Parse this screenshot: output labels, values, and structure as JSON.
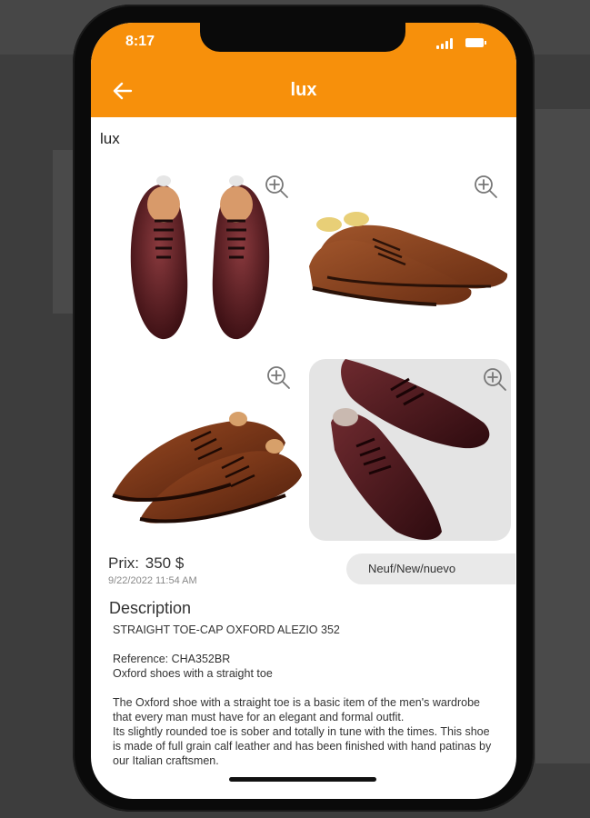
{
  "status": {
    "time": "8:17"
  },
  "appbar": {
    "title": "lux",
    "back_icon": "arrow-left-icon"
  },
  "page_label": "lux",
  "gallery": {
    "zoom_icon": "zoom-in-icon",
    "images": [
      {
        "name": "burgundy-oxford-pair-top-view"
      },
      {
        "name": "brown-cap-toe-oxford-pair"
      },
      {
        "name": "brown-brogue-oxford-pair"
      },
      {
        "name": "burgundy-wholecut-oxford-pair"
      }
    ]
  },
  "listing": {
    "price_label": "Prix:",
    "price_value": "350 $",
    "date": "9/22/2022 11:54 AM",
    "condition": "Neuf/New/nuevo"
  },
  "description": {
    "heading": "Description",
    "title": "STRAIGHT TOE-CAP OXFORD ALEZIO 352",
    "reference": "Reference: CHA352BR",
    "subtitle": "Oxford shoes with a straight toe",
    "paragraph1": "The Oxford shoe with a straight toe is a basic item of the men's wardrobe that every man must have for an elegant and formal outfit.",
    "paragraph2": "Its slightly rounded toe is sober and totally in tune with the times. This shoe is made of full grain calf leather and has been finished with hand patinas by our Italian craftsmen."
  },
  "colors": {
    "accent": "#f7900b",
    "burgundy": "#5e1f24",
    "brown": "#8a4521"
  }
}
